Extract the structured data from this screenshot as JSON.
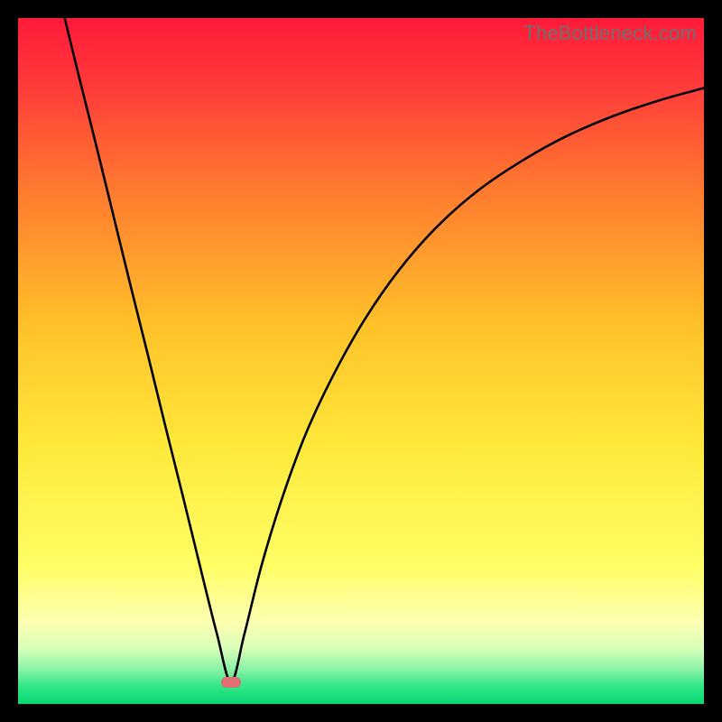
{
  "watermark": "TheBottleneck.com",
  "marker": {
    "color": "#de6f73",
    "x": 0.3105,
    "y_frac_from_top": 0.968
  },
  "chart_data": {
    "type": "line",
    "title": "",
    "xlabel": "",
    "ylabel": "",
    "xlim": [
      0,
      1
    ],
    "ylim": [
      0,
      1
    ],
    "background_gradient": {
      "stops": [
        {
          "pos": 0.0,
          "color": "#ff1a3a"
        },
        {
          "pos": 0.1,
          "color": "#ff3b3a"
        },
        {
          "pos": 0.25,
          "color": "#ff7a2f"
        },
        {
          "pos": 0.45,
          "color": "#ffc22a"
        },
        {
          "pos": 0.62,
          "color": "#ffe83a"
        },
        {
          "pos": 0.8,
          "color": "#ffff66"
        },
        {
          "pos": 0.88,
          "color": "#fdffb0"
        },
        {
          "pos": 0.92,
          "color": "#d7ffb8"
        },
        {
          "pos": 0.95,
          "color": "#88f2a6"
        },
        {
          "pos": 0.975,
          "color": "#2fe688"
        },
        {
          "pos": 1.0,
          "color": "#08d874"
        }
      ]
    },
    "series": [
      {
        "name": "curve",
        "color": "#000000",
        "points": [
          {
            "x": 0.068,
            "y": 1.0
          },
          {
            "x": 0.09,
            "y": 0.91
          },
          {
            "x": 0.115,
            "y": 0.81
          },
          {
            "x": 0.14,
            "y": 0.708
          },
          {
            "x": 0.165,
            "y": 0.606
          },
          {
            "x": 0.19,
            "y": 0.506
          },
          {
            "x": 0.215,
            "y": 0.404
          },
          {
            "x": 0.24,
            "y": 0.304
          },
          {
            "x": 0.265,
            "y": 0.202
          },
          {
            "x": 0.29,
            "y": 0.102
          },
          {
            "x": 0.3105,
            "y": 0.032
          },
          {
            "x": 0.33,
            "y": 0.102
          },
          {
            "x": 0.355,
            "y": 0.202
          },
          {
            "x": 0.385,
            "y": 0.3
          },
          {
            "x": 0.42,
            "y": 0.395
          },
          {
            "x": 0.46,
            "y": 0.48
          },
          {
            "x": 0.505,
            "y": 0.56
          },
          {
            "x": 0.555,
            "y": 0.632
          },
          {
            "x": 0.61,
            "y": 0.695
          },
          {
            "x": 0.67,
            "y": 0.748
          },
          {
            "x": 0.735,
            "y": 0.792
          },
          {
            "x": 0.8,
            "y": 0.828
          },
          {
            "x": 0.87,
            "y": 0.858
          },
          {
            "x": 0.935,
            "y": 0.88
          },
          {
            "x": 1.0,
            "y": 0.898
          }
        ]
      }
    ],
    "marker_point": {
      "x": 0.3105,
      "y": 0.032,
      "color": "#de6f73"
    }
  }
}
